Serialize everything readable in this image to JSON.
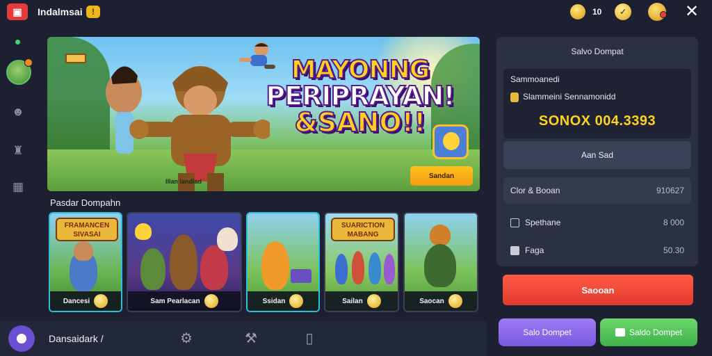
{
  "topbar": {
    "app_title": "Indalmsai",
    "title_badge": "!",
    "coin_count": "10",
    "close_label": "✕"
  },
  "hero": {
    "headline_line1": "MAYONNG",
    "headline_line2": "PERIPRAYAN!",
    "headline_line3": "&SANO!!",
    "caption": "Illan landlad",
    "cta_label": "Sandan"
  },
  "section": {
    "title": "Pasdar Dompahn"
  },
  "cards": [
    {
      "label": "Dancesi",
      "badge": "FRAMANCEN\nSIVASAI",
      "selected": true
    },
    {
      "label": "Sam Pearlacan",
      "badge": "",
      "selected": false
    },
    {
      "label": "Ssidan",
      "badge": "",
      "selected": true
    },
    {
      "label": "Sailan",
      "badge": "SUARICTION\nMABANG",
      "selected": false
    },
    {
      "label": "Saocan",
      "badge": "",
      "selected": false
    }
  ],
  "panel": {
    "title": "Salvo Dompat",
    "wallet_label": "Sammoanedi",
    "wallet_sub": "Slammeini Sennamonidd",
    "wallet_amount": "SONOX 004.3393",
    "action_label": "Aan Sad",
    "rows": [
      {
        "label": "Clor & Booan",
        "value": "910627",
        "checkbox": "none"
      },
      {
        "label": "Spethane",
        "value": "8 000",
        "checkbox": "off"
      },
      {
        "label": "Faga",
        "value": "50.30",
        "checkbox": "on"
      }
    ]
  },
  "actions": {
    "red_label": "Saooan",
    "purple_label": "Salo Dompet",
    "green_label": "Saldo Dompet"
  },
  "bottombar": {
    "label": "Dansaidark /"
  },
  "colors": {
    "background": "#1d2030",
    "panel": "#2b3042",
    "accent_gold": "#ffd21f",
    "red": "#e23a2e",
    "purple": "#7a58df",
    "green": "#3db24a"
  }
}
